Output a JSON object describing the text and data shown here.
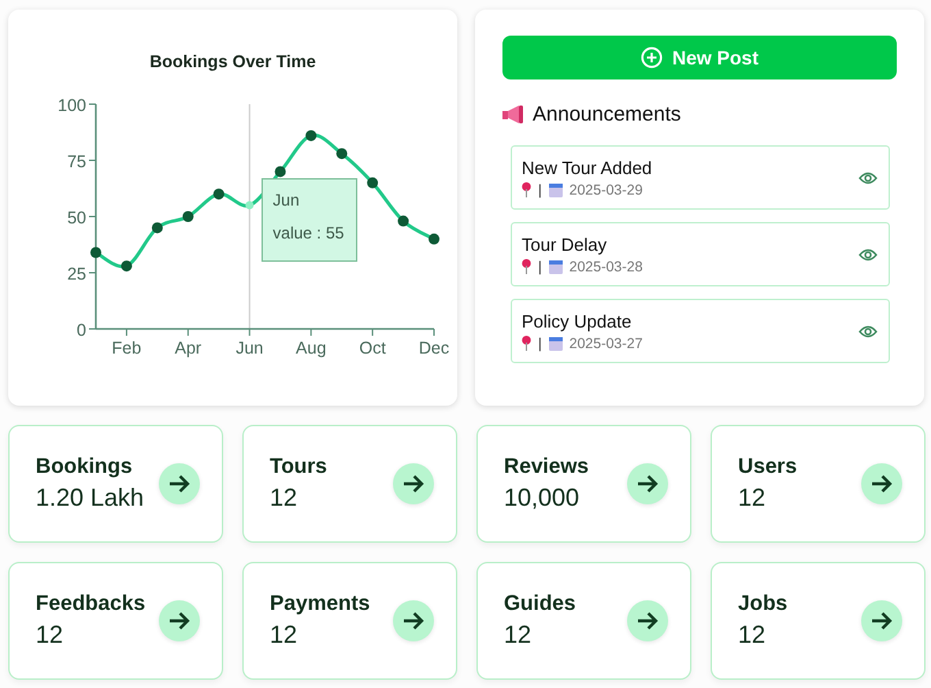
{
  "chart_card": {
    "chart_data": {
      "type": "line",
      "title": "Bookings Over Time",
      "categories": [
        null,
        "Feb",
        null,
        "Apr",
        null,
        "Jun",
        null,
        "Aug",
        null,
        "Oct",
        null,
        "Dec"
      ],
      "series": [
        {
          "color": "#22c98a",
          "marker": true,
          "values": [
            34,
            28,
            45,
            50,
            60,
            55,
            70,
            86,
            78,
            65,
            48,
            40
          ]
        }
      ],
      "ylim": [
        0,
        100
      ],
      "yticks": [
        0,
        25,
        50,
        75,
        100
      ]
    },
    "tooltip": {
      "title": "Jun",
      "text": "value : 55"
    }
  },
  "side_panel": {
    "new_post_button": "New Post",
    "announcements_title": "Announcements",
    "announcements": [
      {
        "title": "New Tour Added",
        "separator": "|",
        "date": "2025-03-29"
      },
      {
        "title": "Tour Delay",
        "separator": "|",
        "date": "2025-03-28"
      },
      {
        "title": "Policy Update",
        "separator": "|",
        "date": "2025-03-27"
      }
    ]
  },
  "stats": [
    {
      "label": "Bookings",
      "value": "1.20 Lakh"
    },
    {
      "label": "Tours",
      "value": "12"
    },
    {
      "label": "Reviews",
      "value": "10,000"
    },
    {
      "label": "Users",
      "value": "12"
    },
    {
      "label": "Feedbacks",
      "value": "12"
    },
    {
      "label": "Payments",
      "value": "12"
    },
    {
      "label": "Guides",
      "value": "12"
    },
    {
      "label": "Jobs",
      "value": "12"
    }
  ]
}
